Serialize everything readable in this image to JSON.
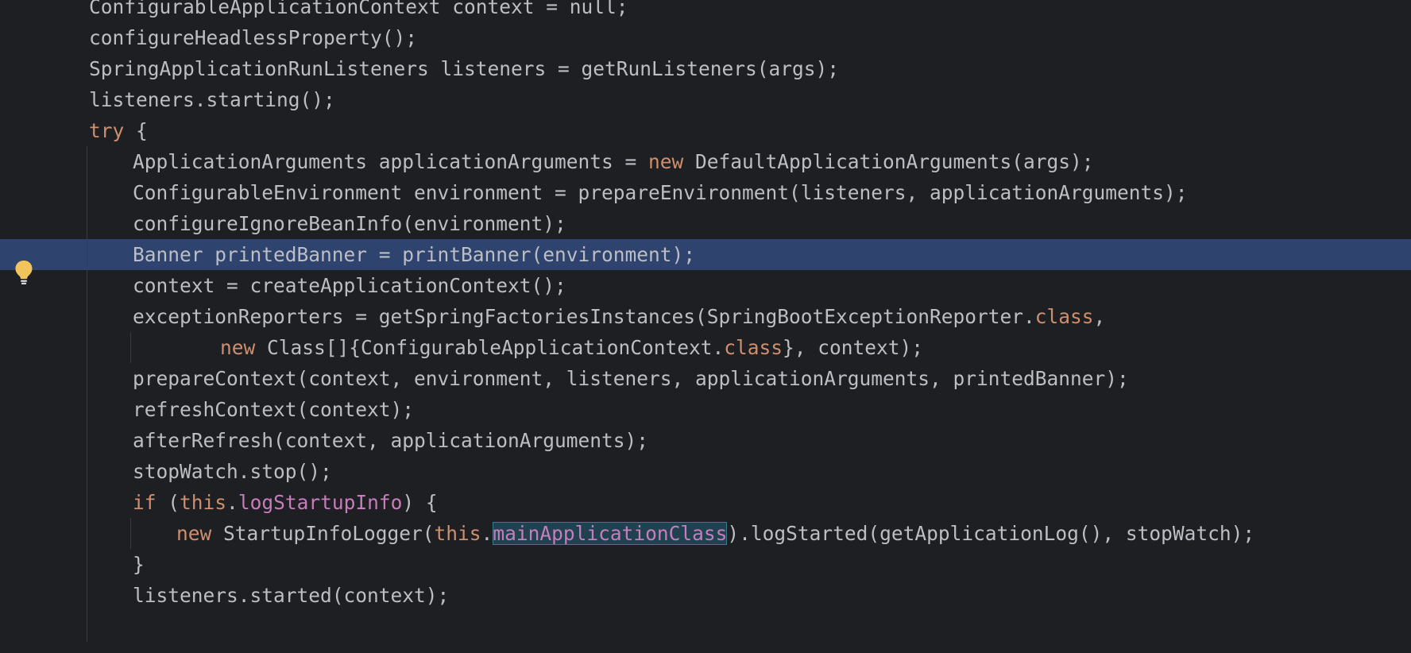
{
  "editor": {
    "theme": {
      "background": "#1e1f22",
      "text": "#bcbec4",
      "keyword": "#cf8e6d",
      "field": "#c77dbb",
      "selected_line": "#2e436e",
      "indent_guide": "#393b40"
    },
    "gutter": {
      "intention_icon": "lightbulb-icon"
    },
    "lines": [
      {
        "indent": 0,
        "tokens": [
          {
            "t": "ConfigurableApplicationContext context = null;"
          }
        ],
        "clipped": true
      },
      {
        "indent": 0,
        "tokens": [
          {
            "t": "configureHeadlessProperty();"
          }
        ]
      },
      {
        "indent": 0,
        "tokens": [
          {
            "t": "SpringApplicationRunListeners listeners = getRunListeners(args);"
          }
        ]
      },
      {
        "indent": 0,
        "tokens": [
          {
            "t": "listeners.starting();"
          }
        ]
      },
      {
        "indent": 0,
        "tokens": [
          {
            "t": "try",
            "c": "kw"
          },
          {
            "t": " {"
          }
        ]
      },
      {
        "indent": 1,
        "tokens": [
          {
            "t": "ApplicationArguments applicationArguments = "
          },
          {
            "t": "new",
            "c": "kw"
          },
          {
            "t": " DefaultApplicationArguments(args);"
          }
        ]
      },
      {
        "indent": 1,
        "tokens": [
          {
            "t": "ConfigurableEnvironment environment = prepareEnvironment(listeners, applicationArguments);"
          }
        ]
      },
      {
        "indent": 1,
        "tokens": [
          {
            "t": "configureIgnoreBeanInfo(environment);"
          }
        ]
      },
      {
        "indent": 1,
        "highlight": true,
        "tokens": [
          {
            "t": "Banner printedBanner = printBanner(environment);"
          }
        ]
      },
      {
        "indent": 1,
        "tokens": [
          {
            "t": "context = createApplicationContext();"
          }
        ]
      },
      {
        "indent": 1,
        "tokens": [
          {
            "t": "exceptionReporters = getSpringFactoriesInstances(SpringBootExceptionReporter."
          },
          {
            "t": "class",
            "c": "kw"
          },
          {
            "t": ","
          }
        ]
      },
      {
        "indent": 3,
        "tokens": [
          {
            "t": "new",
            "c": "kw"
          },
          {
            "t": " Class[]{ConfigurableApplicationContext."
          },
          {
            "t": "class",
            "c": "kw"
          },
          {
            "t": "}, context);"
          }
        ]
      },
      {
        "indent": 1,
        "tokens": [
          {
            "t": "prepareContext(context, environment, listeners, applicationArguments, printedBanner);"
          }
        ]
      },
      {
        "indent": 1,
        "tokens": [
          {
            "t": "refreshContext(context);"
          }
        ]
      },
      {
        "indent": 1,
        "tokens": [
          {
            "t": "afterRefresh(context, applicationArguments);"
          }
        ]
      },
      {
        "indent": 1,
        "tokens": [
          {
            "t": "stopWatch.stop();"
          }
        ]
      },
      {
        "indent": 1,
        "tokens": [
          {
            "t": "if",
            "c": "kw"
          },
          {
            "t": " ("
          },
          {
            "t": "this",
            "c": "kw"
          },
          {
            "t": "."
          },
          {
            "t": "logStartupInfo",
            "c": "fld"
          },
          {
            "t": ") {"
          }
        ]
      },
      {
        "indent": 2,
        "tokens": [
          {
            "t": "new",
            "c": "kw"
          },
          {
            "t": " StartupInfoLogger("
          },
          {
            "t": "this",
            "c": "kw"
          },
          {
            "t": "."
          },
          {
            "t": "mainApplicationClass",
            "c": "fld sel"
          },
          {
            "t": ").logStarted(getApplicationLog(), stopWatch);"
          }
        ]
      },
      {
        "indent": 1,
        "tokens": [
          {
            "t": "}"
          }
        ]
      },
      {
        "indent": 1,
        "tokens": [
          {
            "t": "listeners.started(context);"
          }
        ],
        "clipped": true
      }
    ]
  }
}
